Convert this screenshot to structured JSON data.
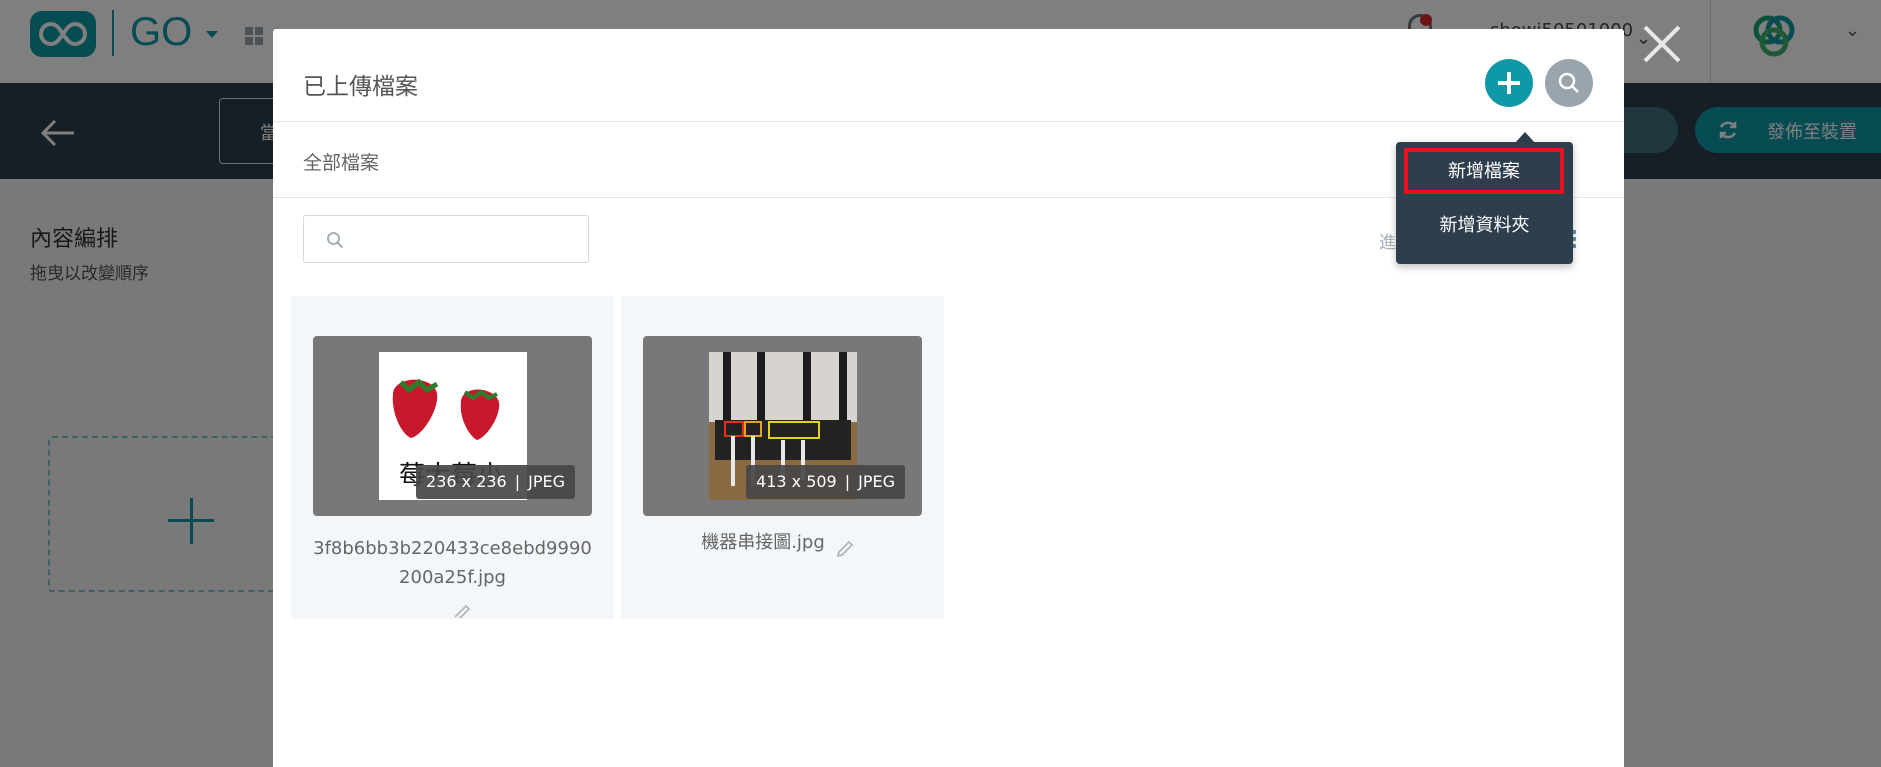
{
  "app": {
    "brand": "GO",
    "user_name": "showi50501000",
    "toolbar_field_text": "當",
    "publish_label": "發佈至裝置"
  },
  "background": {
    "section_title": "內容編排",
    "section_subtitle": "拖曳以改變順序"
  },
  "modal": {
    "title": "已上傳檔案",
    "breadcrumb": "全部檔案",
    "search_placeholder": "",
    "advanced_label": "進階",
    "dropdown": {
      "new_file": "新增檔案",
      "new_folder": "新增資料夾"
    },
    "files": [
      {
        "name": "3f8b6bb3b220433ce8ebd9990200a25f.jpg",
        "dimensions": "236 x 236",
        "format": "JPEG",
        "thumb_caption": "莓大莓小"
      },
      {
        "name": "機器串接圖.jpg",
        "dimensions": "413 x 509",
        "format": "JPEG"
      }
    ]
  },
  "colors": {
    "accent": "#0f98a6",
    "toolbar": "#2e3e4d",
    "highlight": "#e3141c"
  },
  "icons": [
    "logo-icon",
    "apps-icon",
    "bell-icon",
    "org-logo-icon",
    "back-arrow-icon",
    "sync-icon",
    "plus-icon",
    "search-icon",
    "sort-az-icon",
    "grid-view-icon",
    "list-view-icon",
    "pencil-icon",
    "close-icon"
  ]
}
